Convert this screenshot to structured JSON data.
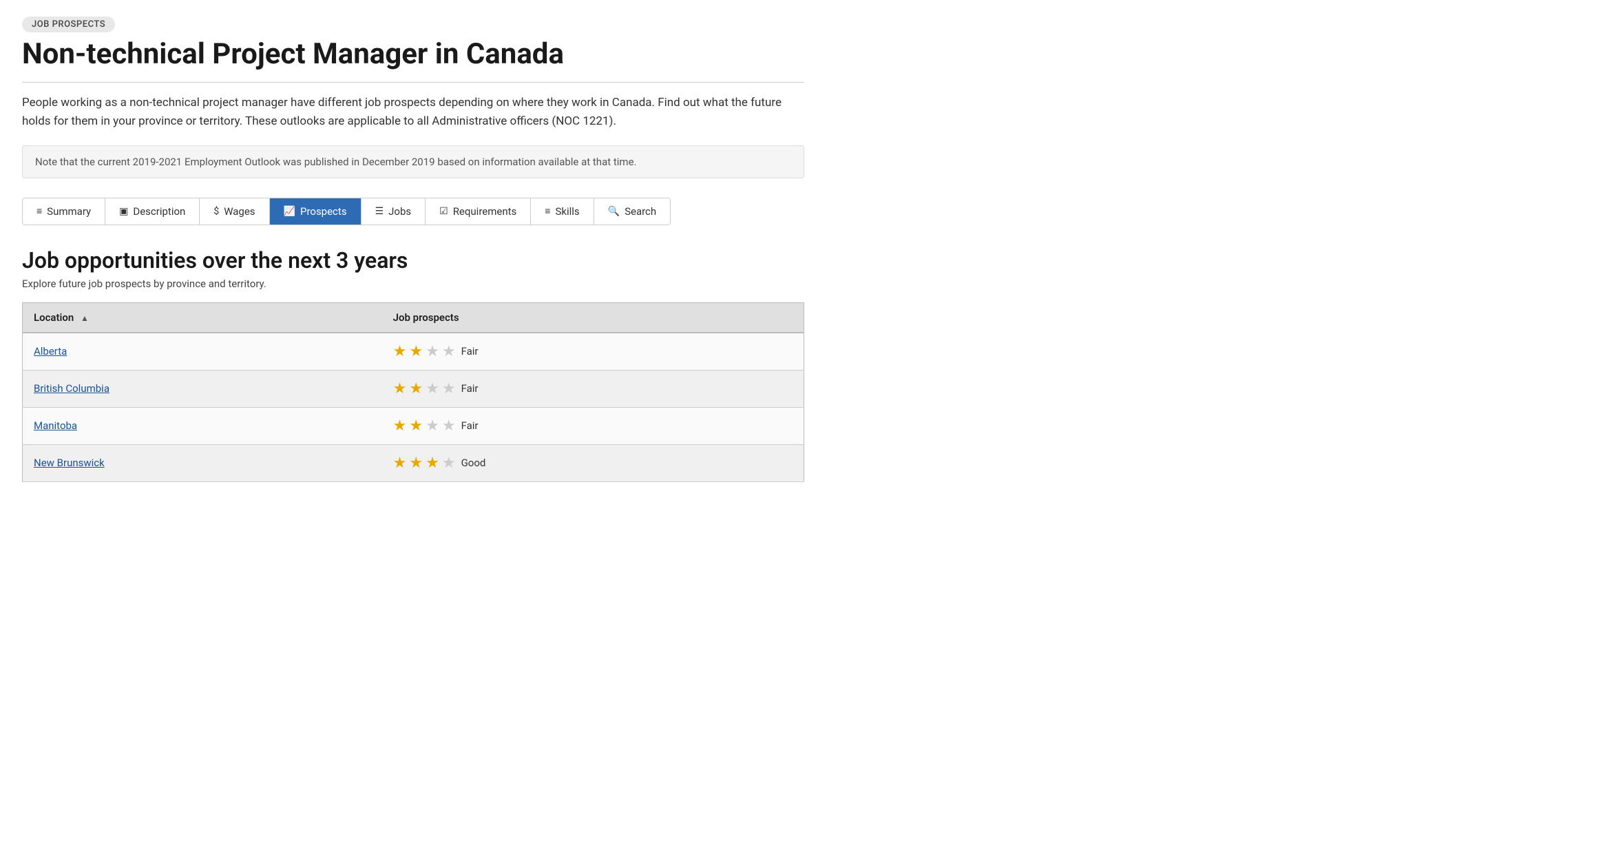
{
  "badge": "JOB PROSPECTS",
  "title": "Non-technical Project Manager in Canada",
  "intro": "People working as a non-technical project manager have different job prospects depending on where they work in Canada. Find out what the future holds for them in your province or territory. These outlooks are applicable to all Administrative officers (NOC 1221).",
  "notice": "Note that the current 2019-2021 Employment Outlook was published in December 2019 based on information available at that time.",
  "tabs": [
    {
      "id": "summary",
      "label": "Summary",
      "icon": "≡",
      "active": false
    },
    {
      "id": "description",
      "label": "Description",
      "icon": "▣",
      "active": false
    },
    {
      "id": "wages",
      "label": "Wages",
      "icon": "$",
      "active": false
    },
    {
      "id": "prospects",
      "label": "Prospects",
      "icon": "📈",
      "active": true
    },
    {
      "id": "jobs",
      "label": "Jobs",
      "icon": "☰",
      "active": false
    },
    {
      "id": "requirements",
      "label": "Requirements",
      "icon": "☑",
      "active": false
    },
    {
      "id": "skills",
      "label": "Skills",
      "icon": "≡",
      "active": false
    },
    {
      "id": "search",
      "label": "Search",
      "icon": "🔍",
      "active": false
    }
  ],
  "section_title": "Job opportunities over the next 3 years",
  "section_subtitle": "Explore future job prospects by province and territory.",
  "table": {
    "col_location": "Location",
    "col_prospects": "Job prospects",
    "rows": [
      {
        "location": "Alberta",
        "rating": 2.5,
        "stars": [
          true,
          true,
          false,
          false
        ],
        "label": "Fair"
      },
      {
        "location": "British Columbia",
        "rating": 2.5,
        "stars": [
          true,
          true,
          false,
          false
        ],
        "label": "Fair"
      },
      {
        "location": "Manitoba",
        "rating": 2.5,
        "stars": [
          true,
          true,
          false,
          false
        ],
        "label": "Fair"
      },
      {
        "location": "New Brunswick",
        "rating": 3,
        "stars": [
          true,
          true,
          true,
          false
        ],
        "label": "Good"
      }
    ]
  },
  "colors": {
    "star_filled": "#e8a800",
    "star_empty": "#cccccc",
    "active_tab_bg": "#2d6cb4",
    "link_color": "#1a5296"
  }
}
